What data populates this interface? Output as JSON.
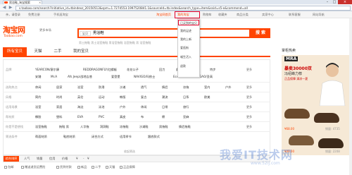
{
  "browser": {
    "tab_title": "男浴鞋_淘宝搜索",
    "url": "s.taobao.com/search?initiative_id=tbindexz_20150513&spm=1.7274553.1997520841.1&sourceId=tb.index&search_type=item&ssid=s5-e&commend=all"
  },
  "topbar": {
    "links": [
      "亲，请登录",
      "免费注册",
      "手机逛淘宝",
      "淘宝网首页",
      "我的淘宝",
      "购物车",
      "收藏夹",
      "商品分类",
      "卖家中心",
      "联系客服",
      "网站导航"
    ]
  },
  "header": {
    "logo": "淘宝网",
    "logo_sub": "Taobao.com",
    "more_link": "更多市场",
    "scope": "宝贝",
    "query": "男浴鞋",
    "search_btn": "搜 索",
    "hot_words": "男士拖鞋  男士浴室拖鞋  男浴室拖鞋  浴室拖鞋 男  浴室拖鞋"
  },
  "dropdown": {
    "items": [
      "已买到的宝贝",
      "我的足迹",
      "我的上新",
      "爱逛街",
      "喵生活入",
      "退款"
    ]
  },
  "tabs": [
    "所有宝贝",
    "天猫",
    "二手",
    "我的宝贝"
  ],
  "filters": {
    "rows": [
      {
        "label": "品牌",
        "cells": [
          "YEARCON/意尔康",
          "REDDRAGONFLY/红蜻蜓",
          "花花公子",
          "回力",
          "彪马",
          "骆驼",
          "特步",
          "安踏",
          "Mr.A",
          "Afs Jeep/战地吉普",
          "爱登堡",
          "NAVIGO/玛依士",
          "Ecco",
          "SHEN GAO/圣高"
        ],
        "more": "更多"
      },
      {
        "label": "选购热点",
        "cells": [
          "休闲",
          "居家",
          "浴室",
          "防滑",
          "沙滩",
          "透气",
          "情侣",
          "凉拖",
          "室内",
          "户外"
        ],
        "more": "更多"
      },
      {
        "label": "风格",
        "cells": [
          "简约",
          "时尚",
          "英伦",
          "运动",
          "韩版",
          "复古",
          "潮流",
          "日系",
          "欧美"
        ],
        "more": "更多"
      },
      {
        "label": "适用场景",
        "cells": [
          "浴室",
          "家居",
          "海边",
          "泳池",
          "户外",
          "休闲",
          "日常",
          "旅行"
        ],
        "more": "更多"
      },
      {
        "label": "帮材质",
        "cells": [
          "橡胶",
          "塑料",
          "EVA",
          "PVC",
          "真皮",
          "布",
          "棉",
          "亚麻"
        ],
        "more": "更多"
      },
      {
        "label": "你是不是想找",
        "cells": [
          "浴室拖鞋",
          "拖鞋 男",
          "人字拖",
          "洞洞鞋",
          "凉拖鞋",
          "沙滩鞋",
          "男拖鞋",
          "情侣拖鞋"
        ],
        "more": "更多"
      },
      {
        "label": "筛选条件",
        "cells": [
          "帮面材质",
          "鞋底材质",
          "闭合方式",
          "适用季节",
          "跟底款式"
        ],
        "more": ""
      }
    ],
    "collapse": "收起筛选"
  },
  "sort": {
    "items": [
      "综合排序",
      "人气",
      "销量",
      "信用",
      "价格",
      "¥",
      "-",
      "¥"
    ],
    "filter_items": [
      "包邮",
      "赠送退货运费险",
      "货到付款",
      "新品",
      "二手",
      "天猫",
      "正品保障"
    ]
  },
  "right": {
    "title": "掌柜热卖",
    "brand": "MRA",
    "promo": "暴卖30000双",
    "promo2": "冯绍峰力荐",
    "promo3": "正品保障 清凉一夏",
    "products": [
      {
        "price": "¥68.00",
        "sales": "销量: 4735"
      },
      {
        "price": "¥49.00",
        "sales": "销量: 2208"
      }
    ]
  },
  "watermark": {
    "text": "我爱IT技术网",
    "sub": "www.52ij.com"
  },
  "colors": {
    "accent": "#ff4400",
    "alert_red": "#e4002b"
  }
}
